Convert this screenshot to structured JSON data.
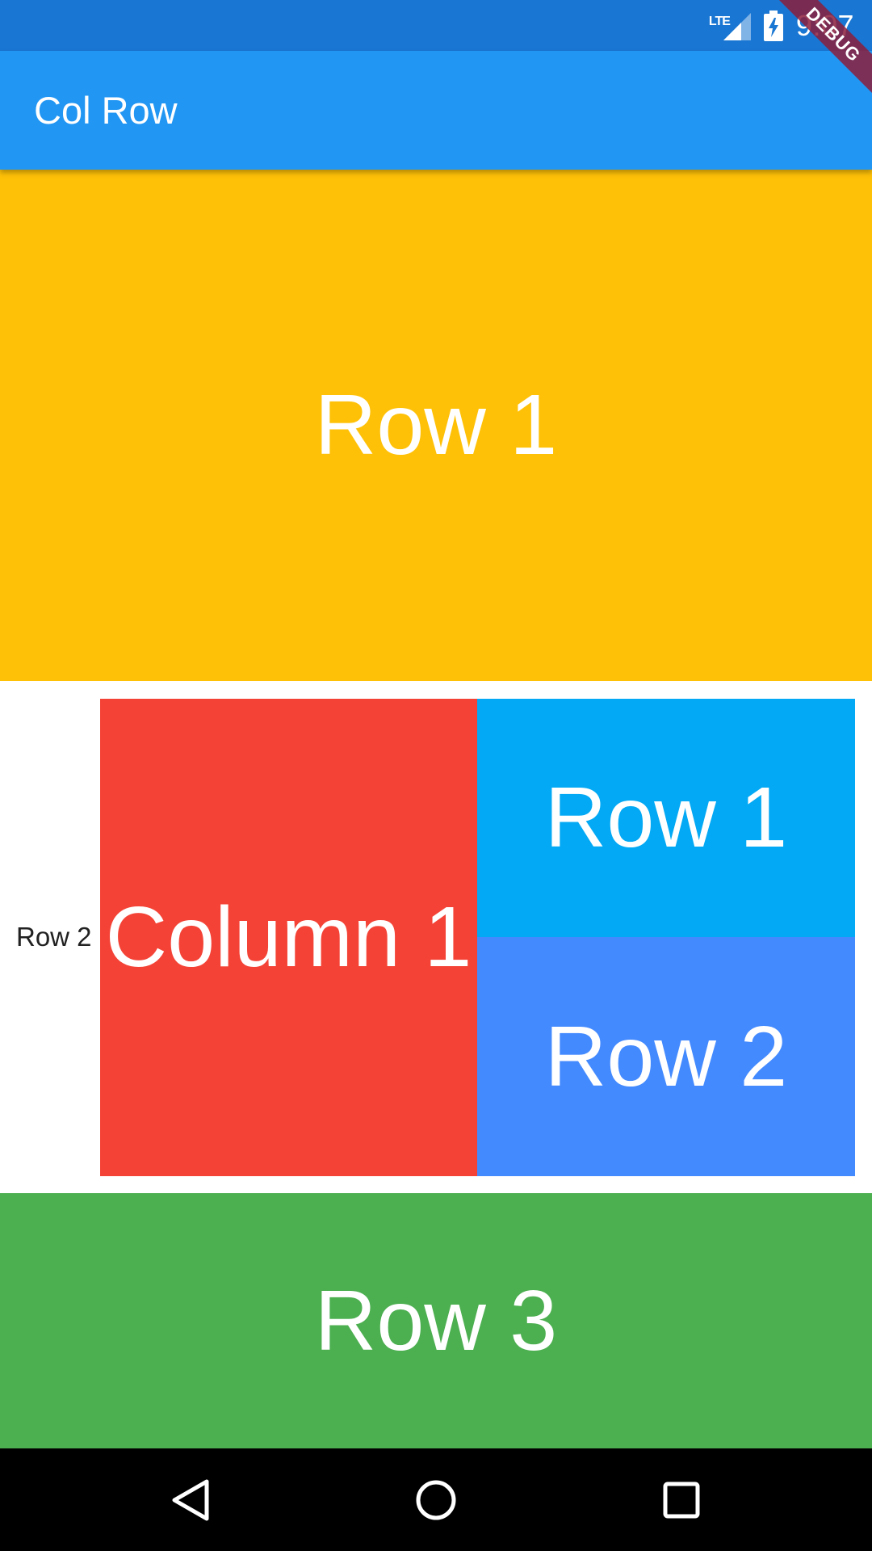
{
  "status_bar": {
    "network_label": "LTE",
    "time": "9:07",
    "color": "#1976d2"
  },
  "debug_banner": {
    "label": "DEBUG"
  },
  "app_bar": {
    "title": "Col Row",
    "color": "#2196f3"
  },
  "layout": {
    "row1": {
      "label": "Row 1",
      "color": "#ffc107"
    },
    "row2": {
      "label": "Row 2",
      "column1": {
        "label": "Column 1",
        "color": "#f44336"
      },
      "nested_row1": {
        "label": "Row 1",
        "color": "#03a9f4"
      },
      "nested_row2": {
        "label": "Row 2",
        "color": "#448aff"
      }
    },
    "row3": {
      "label": "Row 3",
      "color": "#4caf50"
    }
  },
  "nav_bar": {
    "icons": [
      "back-icon",
      "home-icon",
      "recents-icon"
    ]
  }
}
